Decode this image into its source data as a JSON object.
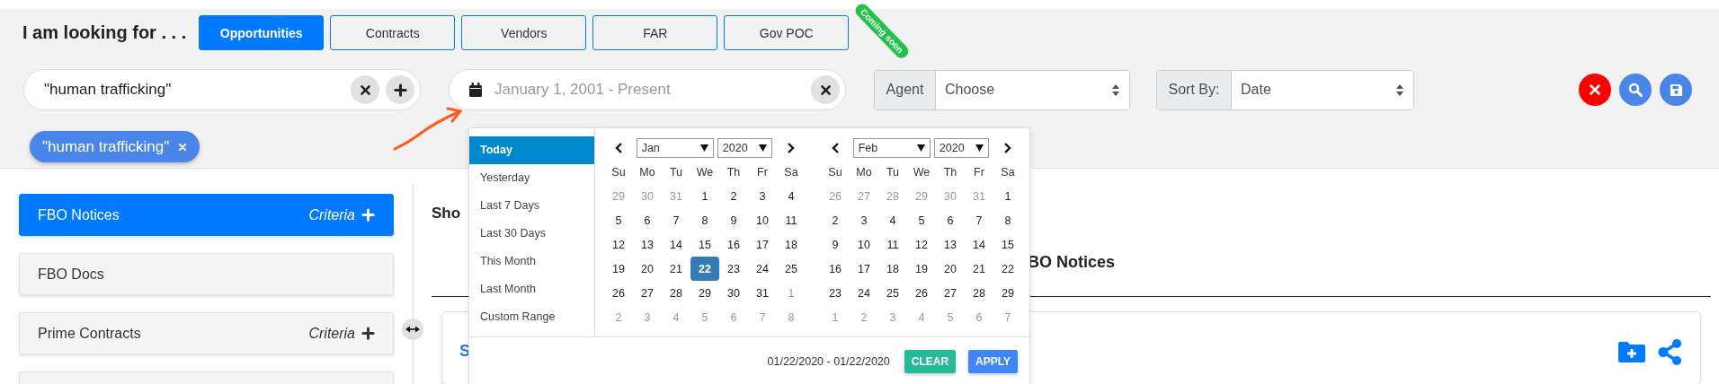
{
  "prompt": "I am looking for . . .",
  "categories": [
    {
      "label": "Opportunities",
      "selected": true
    },
    {
      "label": "Contracts",
      "selected": false
    },
    {
      "label": "Vendors",
      "selected": false
    },
    {
      "label": "FAR",
      "selected": false
    },
    {
      "label": "Gov POC",
      "selected": false,
      "badge": "Coming soon"
    }
  ],
  "keyword_field": {
    "value": "\"human trafficking\""
  },
  "date_field": {
    "placeholder": "January 1, 2001 - Present"
  },
  "agent": {
    "label": "Agent",
    "value": "Choose"
  },
  "sort": {
    "label": "Sort By:",
    "value": "Date"
  },
  "chips": [
    {
      "label": "\"human trafficking\""
    }
  ],
  "sidebar": {
    "items": [
      {
        "label": "FBO Notices",
        "selected": true,
        "criteria": "Criteria"
      },
      {
        "label": "FBO Docs",
        "selected": false
      },
      {
        "label": "Prime Contracts",
        "selected": false,
        "criteria": "Criteria"
      },
      {
        "selected": false
      }
    ]
  },
  "results": {
    "heading": "Sho",
    "title": "BO Notices",
    "card": {
      "link": "S"
    }
  },
  "date_picker": {
    "ranges": [
      {
        "label": "Today",
        "selected": true
      },
      {
        "label": "Yesterday",
        "selected": false
      },
      {
        "label": "Last 7 Days",
        "selected": false
      },
      {
        "label": "Last 30 Days",
        "selected": false
      },
      {
        "label": "This Month",
        "selected": false
      },
      {
        "label": "Last Month",
        "selected": false
      },
      {
        "label": "Custom Range",
        "selected": false
      }
    ],
    "calendars": [
      {
        "month": "Jan",
        "year": "2020",
        "weekdays": [
          "Su",
          "Mo",
          "Tu",
          "We",
          "Th",
          "Fr",
          "Sa"
        ],
        "weeks": [
          [
            {
              "day": "29",
              "muted": true,
              "selected": false
            },
            {
              "day": "30",
              "muted": true,
              "selected": false
            },
            {
              "day": "31",
              "muted": true,
              "selected": false
            },
            {
              "day": "1",
              "muted": false,
              "selected": false
            },
            {
              "day": "2",
              "muted": false,
              "selected": false
            },
            {
              "day": "3",
              "muted": false,
              "selected": false
            },
            {
              "day": "4",
              "muted": false,
              "selected": false
            }
          ],
          [
            {
              "day": "5",
              "muted": false,
              "selected": false
            },
            {
              "day": "6",
              "muted": false,
              "selected": false
            },
            {
              "day": "7",
              "muted": false,
              "selected": false
            },
            {
              "day": "8",
              "muted": false,
              "selected": false
            },
            {
              "day": "9",
              "muted": false,
              "selected": false
            },
            {
              "day": "10",
              "muted": false,
              "selected": false
            },
            {
              "day": "11",
              "muted": false,
              "selected": false
            }
          ],
          [
            {
              "day": "12",
              "muted": false,
              "selected": false
            },
            {
              "day": "13",
              "muted": false,
              "selected": false
            },
            {
              "day": "14",
              "muted": false,
              "selected": false
            },
            {
              "day": "15",
              "muted": false,
              "selected": false
            },
            {
              "day": "16",
              "muted": false,
              "selected": false
            },
            {
              "day": "17",
              "muted": false,
              "selected": false
            },
            {
              "day": "18",
              "muted": false,
              "selected": false
            }
          ],
          [
            {
              "day": "19",
              "muted": false,
              "selected": false
            },
            {
              "day": "20",
              "muted": false,
              "selected": false
            },
            {
              "day": "21",
              "muted": false,
              "selected": false
            },
            {
              "day": "22",
              "muted": false,
              "selected": true
            },
            {
              "day": "23",
              "muted": false,
              "selected": false
            },
            {
              "day": "24",
              "muted": false,
              "selected": false
            },
            {
              "day": "25",
              "muted": false,
              "selected": false
            }
          ],
          [
            {
              "day": "26",
              "muted": false,
              "selected": false
            },
            {
              "day": "27",
              "muted": false,
              "selected": false
            },
            {
              "day": "28",
              "muted": false,
              "selected": false
            },
            {
              "day": "29",
              "muted": false,
              "selected": false
            },
            {
              "day": "30",
              "muted": false,
              "selected": false
            },
            {
              "day": "31",
              "muted": false,
              "selected": false
            },
            {
              "day": "1",
              "muted": true,
              "selected": false
            }
          ],
          [
            {
              "day": "2",
              "muted": true,
              "selected": false
            },
            {
              "day": "3",
              "muted": true,
              "selected": false
            },
            {
              "day": "4",
              "muted": true,
              "selected": false
            },
            {
              "day": "5",
              "muted": true,
              "selected": false
            },
            {
              "day": "6",
              "muted": true,
              "selected": false
            },
            {
              "day": "7",
              "muted": true,
              "selected": false
            },
            {
              "day": "8",
              "muted": true,
              "selected": false
            }
          ]
        ]
      },
      {
        "month": "Feb",
        "year": "2020",
        "weekdays": [
          "Su",
          "Mo",
          "Tu",
          "We",
          "Th",
          "Fr",
          "Sa"
        ],
        "weeks": [
          [
            {
              "day": "26",
              "muted": true,
              "selected": false
            },
            {
              "day": "27",
              "muted": true,
              "selected": false
            },
            {
              "day": "28",
              "muted": true,
              "selected": false
            },
            {
              "day": "29",
              "muted": true,
              "selected": false
            },
            {
              "day": "30",
              "muted": true,
              "selected": false
            },
            {
              "day": "31",
              "muted": true,
              "selected": false
            },
            {
              "day": "1",
              "muted": false,
              "selected": false
            }
          ],
          [
            {
              "day": "2",
              "muted": false,
              "selected": false
            },
            {
              "day": "3",
              "muted": false,
              "selected": false
            },
            {
              "day": "4",
              "muted": false,
              "selected": false
            },
            {
              "day": "5",
              "muted": false,
              "selected": false
            },
            {
              "day": "6",
              "muted": false,
              "selected": false
            },
            {
              "day": "7",
              "muted": false,
              "selected": false
            },
            {
              "day": "8",
              "muted": false,
              "selected": false
            }
          ],
          [
            {
              "day": "9",
              "muted": false,
              "selected": false
            },
            {
              "day": "10",
              "muted": false,
              "selected": false
            },
            {
              "day": "11",
              "muted": false,
              "selected": false
            },
            {
              "day": "12",
              "muted": false,
              "selected": false
            },
            {
              "day": "13",
              "muted": false,
              "selected": false
            },
            {
              "day": "14",
              "muted": false,
              "selected": false
            },
            {
              "day": "15",
              "muted": false,
              "selected": false
            }
          ],
          [
            {
              "day": "16",
              "muted": false,
              "selected": false
            },
            {
              "day": "17",
              "muted": false,
              "selected": false
            },
            {
              "day": "18",
              "muted": false,
              "selected": false
            },
            {
              "day": "19",
              "muted": false,
              "selected": false
            },
            {
              "day": "20",
              "muted": false,
              "selected": false
            },
            {
              "day": "21",
              "muted": false,
              "selected": false
            },
            {
              "day": "22",
              "muted": false,
              "selected": false
            }
          ],
          [
            {
              "day": "23",
              "muted": false,
              "selected": false
            },
            {
              "day": "24",
              "muted": false,
              "selected": false
            },
            {
              "day": "25",
              "muted": false,
              "selected": false
            },
            {
              "day": "26",
              "muted": false,
              "selected": false
            },
            {
              "day": "27",
              "muted": false,
              "selected": false
            },
            {
              "day": "28",
              "muted": false,
              "selected": false
            },
            {
              "day": "29",
              "muted": false,
              "selected": false
            }
          ],
          [
            {
              "day": "1",
              "muted": true,
              "selected": false
            },
            {
              "day": "2",
              "muted": true,
              "selected": false
            },
            {
              "day": "3",
              "muted": true,
              "selected": false
            },
            {
              "day": "4",
              "muted": true,
              "selected": false
            },
            {
              "day": "5",
              "muted": true,
              "selected": false
            },
            {
              "day": "6",
              "muted": true,
              "selected": false
            },
            {
              "day": "7",
              "muted": true,
              "selected": false
            }
          ]
        ]
      }
    ],
    "range_text": "01/22/2020 - 01/22/2020",
    "buttons": [
      {
        "label": "CLEAR",
        "kind": "clear"
      },
      {
        "label": "APPLY",
        "kind": "apply"
      }
    ]
  }
}
